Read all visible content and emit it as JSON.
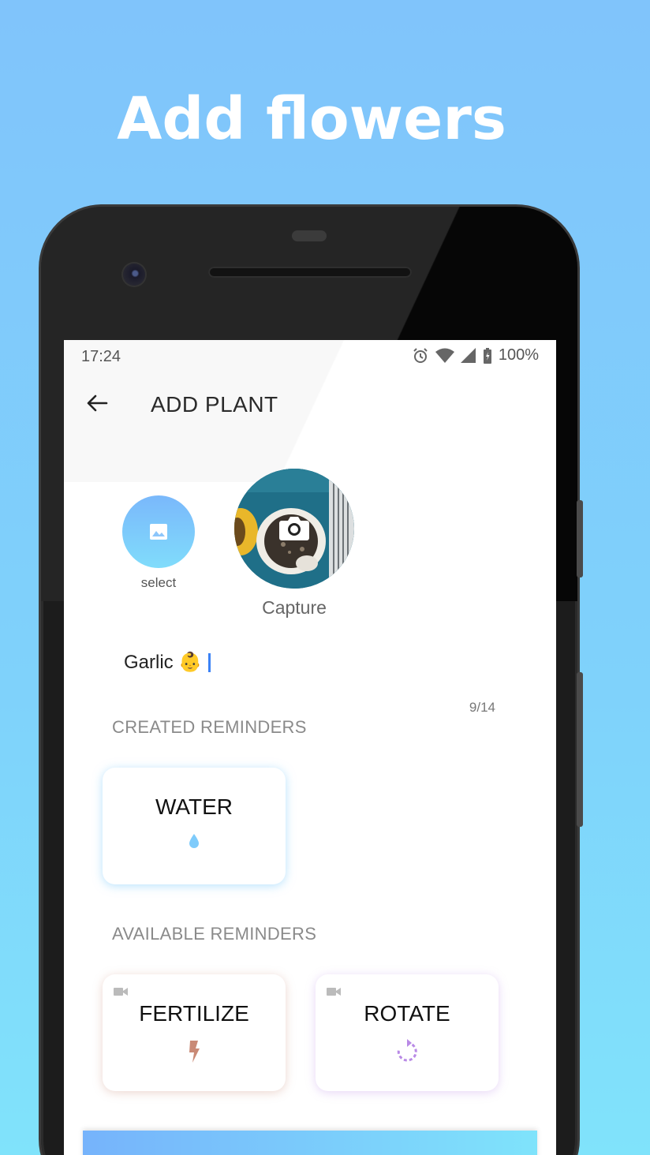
{
  "headline": "Add flowers",
  "status_bar": {
    "time": "17:24",
    "battery": "100%",
    "icons": [
      "alarm-icon",
      "wifi-icon",
      "signal-icon",
      "battery-icon"
    ]
  },
  "app_bar": {
    "back_icon": "arrow-back-icon",
    "title": "ADD PLANT"
  },
  "photo": {
    "select_label": "select",
    "capture_label": "Capture"
  },
  "plant_name": {
    "value": "Garlic 👶",
    "counter": "9/14"
  },
  "created_reminders": {
    "title": "CREATED REMINDERS",
    "items": [
      {
        "label": "WATER",
        "icon": "water-drop-icon",
        "color": "#7ecbfb"
      }
    ]
  },
  "available_reminders": {
    "title": "AVAILABLE REMINDERS",
    "items": [
      {
        "label": "FERTILIZE",
        "icon": "bolt-icon",
        "color": "#c98a76"
      },
      {
        "label": "ROTATE",
        "icon": "rotate-icon",
        "color": "#b98ae6"
      }
    ]
  },
  "colors": {
    "background_top": "#80c4fb",
    "background_bottom": "#80e3fb",
    "accent": "#7ab8fb"
  }
}
